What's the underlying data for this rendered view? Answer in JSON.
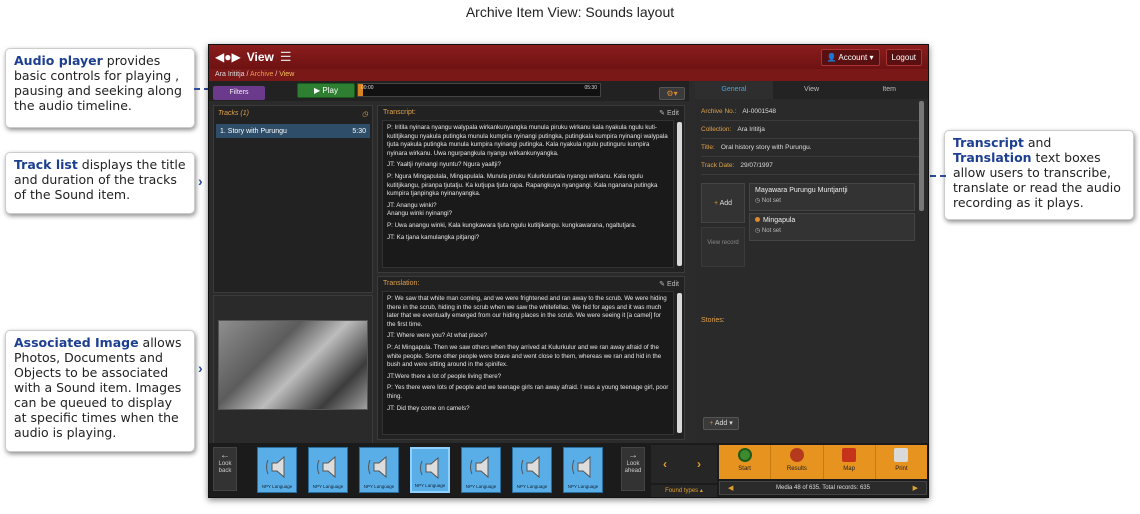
{
  "diagram_title": "Archive Item View: Sounds layout",
  "callouts": {
    "audio_player": {
      "bold": "Audio player",
      "text": " provides basic controls for playing , pausing and seeking along the audio timeline."
    },
    "track_list": {
      "bold": "Track list",
      "text": " displays the title and duration of the tracks of the Sound item."
    },
    "associated_image": {
      "bold": "Associated Image",
      "text": " allows Photos, Documents and Objects to be associated with a Sound item.  Images can be queued to display at specific times when the audio is playing."
    },
    "transcript": {
      "bold1": "Transcript",
      "mid": " and ",
      "bold2": "Translation",
      "text": " text boxes allow users to transcribe, translate or read the audio recording as it plays."
    }
  },
  "app": {
    "title": "View",
    "account_label": "Account",
    "logout_label": "Logout",
    "breadcrumb": {
      "home": "Ara Irititja",
      "archive": "Archive",
      "current": "View"
    },
    "filter_label": "Filters",
    "play_label": "Play",
    "time_start": "00:00",
    "time_end": "05:30",
    "progress": 0.02,
    "tracks": {
      "header": "Tracks (1)",
      "items": [
        {
          "title": "1. Story with Purungu",
          "duration": "5:30"
        }
      ]
    },
    "transcript": {
      "label": "Transcript:",
      "edit": "Edit",
      "paragraphs": [
        "P: Iritila nyinara nyangu walypala wirkankunyangka munula piruku wirkanu kala nyakula ngulu kuti-kutitjikangu nyakula putingka munula kumpira nyinangi putingka, putingkala kumpira nyinangi walypala tjuta nyakula putingka munula kumpira nyinangi putingka. Kala nyakula ngulu putinguru kumpira nyinara wirkanu. Uwa ngurpangkula nyangu wirkankunyangka.",
        "JT: Yaaltji nyinangi nyuntu? Ngura yaaltji?",
        "P: Ngura Mingapulala, Mingapulala. Munula piruku Kulurkulurtala nyangu wirkanu. Kala ngulu kutitjikangu, piranpa tjutatju. Ka kutjupa tjuta rapa. Rapangkuya nyangangi. Kala nganana putingka kumpira tjanpingka nyinanyangka.",
        "JT: Anangu winki?\nAnangu winki nyinangi?",
        "P: Uwa anangu winki, Kala kungkawara tjuta ngulu kutitjikangu. kungkawarana, ngaltutjara.",
        "JT: Ka tjana kamulangka pitjangi?"
      ]
    },
    "translation": {
      "label": "Translation:",
      "edit": "Edit",
      "paragraphs": [
        "P: We saw that white man coming, and we were frightened and ran away to the scrub. We were hiding there in the scrub, hiding in the scrub when we saw the whitefellas. We hid for ages and it was much later that we eventually emerged from our hiding places in the scrub. We were seeing it [a camel] for the first time.",
        "JT: Where were you? At what place?",
        "P: At Mingapula. Then we saw others when they arrived at Kulurkulur and we ran away afraid of the white people. Some other people were brave and went close to them, whereas we ran and hid in the bush and were sitting around in the spinifex.",
        "JT:Were there a lot of people living there?",
        "P: Yes there were lots of people and we teenage girls ran away afraid. I was a young teenage girl, poor thing.",
        "JT: Did they come on camels?"
      ]
    },
    "tabs": [
      "General",
      "View",
      "Item"
    ],
    "fields": [
      {
        "k": "Archive No.:",
        "v": "AI-0001548"
      },
      {
        "k": "Collection:",
        "v": "Ara Irititja"
      },
      {
        "k": "Title:",
        "v": "Oral history story with Purungu."
      },
      {
        "k": "Track Date:",
        "v": "29/07/1997"
      }
    ],
    "places": {
      "add_label": "Add",
      "view_record_label": "View record",
      "items": [
        {
          "name": "Mayawara Purungu Muntjantji",
          "sub": "Not set"
        },
        {
          "name": "Mingapula",
          "sub": "Not set"
        }
      ]
    },
    "stories_label": "Stories:",
    "add_button_label": "Add",
    "bottom": {
      "look_back": "Look back",
      "look_ahead": "Look ahead",
      "thumb_label": "NPY Language",
      "found_types": "Found types",
      "actions": [
        "Start",
        "Results",
        "Map",
        "Print"
      ],
      "status": "Media 48 of 635. Total records: 635"
    },
    "colors": {
      "accent": "#e7931f",
      "header": "#7a1717",
      "thumb": "#5aaee8"
    }
  }
}
